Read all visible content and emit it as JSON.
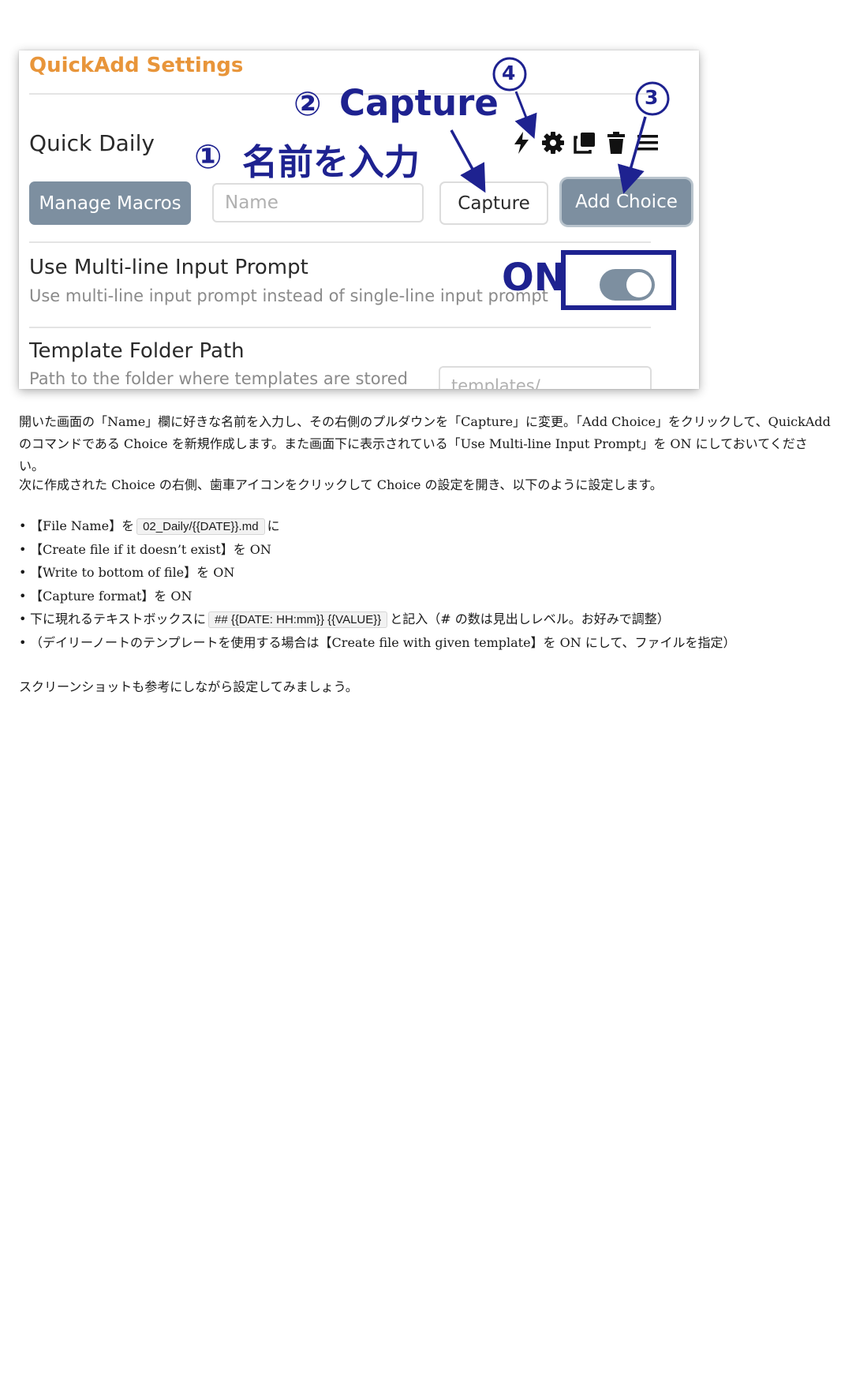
{
  "screenshot": {
    "title": "QuickAdd Settings",
    "choice_name": "Quick Daily",
    "manage_macros_label": "Manage Macros",
    "name_placeholder": "Name",
    "choice_type": "Capture",
    "add_choice_label": "Add Choice",
    "multiline_title": "Use Multi-line Input Prompt",
    "multiline_desc": "Use multi-line input prompt instead of single-line input prompt",
    "multiline_enabled": true,
    "template_folder_title": "Template Folder Path",
    "template_folder_desc": "Path to the folder where templates are stored",
    "template_folder_placeholder": "templates/",
    "icons": [
      "lightning-icon",
      "gear-icon",
      "duplicate-icon",
      "trash-icon",
      "menu-icon"
    ],
    "annotation_color": "#1e2290",
    "annotations": {
      "a1_num": "①",
      "a1_text": "名前を入力",
      "a2_num": "②",
      "a2_text": "Capture",
      "a3_num": "3",
      "a4_num": "4",
      "on_label": "ON"
    }
  },
  "article": {
    "p1": "開いた画面の「Name」欄に好きな名前を入力し、その右側のプルダウンを「Capture」に変更。「Add Choice」をクリックして、QuickAddのコマンドである Choice を新規作成します。また画面下に表示されている「Use Multi-line Input Prompt」を ON にしておいてください。",
    "p2": "次に作成された Choice の右側、歯車アイコンをクリックして Choice の設定を開き、以下のように設定します。",
    "steps": {
      "s1_pre": "【File Name】を",
      "s1_code": "02_Daily/{{DATE}}.md",
      "s1_post": "に",
      "s2": "【Create file if it doesn’t exist】を ON",
      "s3": "【Write to bottom of file】を ON",
      "s4": "【Capture format】を ON",
      "s5_pre": "下に現れるテキストボックスに",
      "s5_code": "## {{DATE: HH:mm}} {{VALUE}}",
      "s5_post": "と記入（# の数は見出しレベル。お好みで調整）",
      "s6": "（デイリーノートのテンプレートを使用する場合は【Create file with given template】を ON にして、ファイルを指定）"
    },
    "p3": "スクリーンショットも参考にしながら設定してみましょう。",
    "bullet": "•"
  }
}
